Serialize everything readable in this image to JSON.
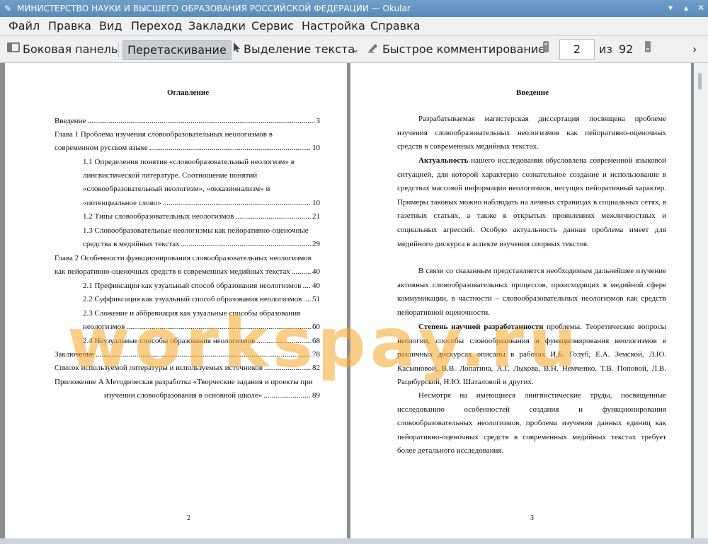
{
  "window": {
    "title": "МИНИСТЕРСТВО НАУКИ И ВЫСШЕГО ОБРАЗОВАНИЯ РОССИЙСКОЙ ФЕДЕРАЦИИ  — Okular",
    "icons": {
      "app": "okular-app-icon",
      "minimize": "minimize-icon",
      "maximize": "maximize-icon",
      "close": "close-icon"
    }
  },
  "menu": [
    "Файл",
    "Правка",
    "Вид",
    "Переход",
    "Закладки",
    "Сервис",
    "Настройка",
    "Справка"
  ],
  "toolbar": {
    "sidebar": "Боковая панель",
    "drag": "Перетаскивание",
    "select_text": "Выделение текста",
    "quick_comment": "Быстрое комментирование",
    "page_current": "2",
    "page_of": "из",
    "page_total": "92"
  },
  "left_page": {
    "title": "Оглавление",
    "page_number": "2",
    "toc": [
      {
        "text": "Введение",
        "page": "3"
      },
      {
        "text": "Глава 1 Проблема изучения словообразовательных неологизмов в",
        "page": ""
      },
      {
        "text": "современном русском языке",
        "page": "10"
      },
      {
        "text": "1.1 Определения понятия «словообразовательный неологизм» в",
        "page": ""
      },
      {
        "text": "лингвистической литературе. Соотношение понятий",
        "page": ""
      },
      {
        "text": "«словообразовательный неологизм», «окказионализм» и",
        "page": ""
      },
      {
        "text": "«потенциальное слово»",
        "page": "10"
      },
      {
        "text": "1.2 Типы словообразовательных неологизмов",
        "page": "21"
      },
      {
        "text": "1.3 Словообразовательные неологизмы как пейоративно-оценочные",
        "page": ""
      },
      {
        "text": "средства в медийных текстах",
        "page": "29"
      },
      {
        "text": "Глава 2 Особенности функционирования словообразовательных неологизмов",
        "page": ""
      },
      {
        "text": "как пейоративно-оценочных средств в современных медийных текстах",
        "page": "40"
      },
      {
        "text": "2.1 Префиксация как узуальный способ образования неологизмов",
        "page": "40"
      },
      {
        "text": "2.2 Суффиксация как узуальный способ образования неологизмов",
        "page": "51"
      },
      {
        "text": "2.3 Сложение и аббревиация как узуальные способы образования",
        "page": ""
      },
      {
        "text": "неологизмов",
        "page": "60"
      },
      {
        "text": "2.4 Неузуальные способы образования неологизмов",
        "page": "68"
      },
      {
        "text": "Заключение",
        "page": "78"
      },
      {
        "text": "Список используемой литературы и используемых источников",
        "page": "82"
      },
      {
        "text": "Приложение А Методическая разработка «Творческие задания и проекты при",
        "page": ""
      },
      {
        "text": "изучении словообразования в основной школе»",
        "page": "89"
      }
    ]
  },
  "right_page": {
    "title": "Введение",
    "page_number": "3",
    "paragraphs": [
      {
        "bold": "",
        "text": "Разрабатываемая магистерская диссертация посвящена проблеме изучения словообразовательных неологизмов как пейоративно-оценочных средств в современных медийных текстах."
      },
      {
        "bold": "Актуальность",
        "text": " нашего исследования обусловлена современной языковой ситуацией, для которой характерно сознательное создание и использование в средствах массовой информации неологизмов, несущих пейоративный характер. Примеры таковых можно наблюдать на личных страницах в социальных сетях, в газетных статьях, а также в открытых проявлениях межличностных и социальных агрессий. Особую актуальность данная проблема имеет для медийного дискурса в аспекте изучения спорных текстов."
      },
      {
        "bold": "",
        "text": "В связи со сказанным представляется необходимым дальнейшее изучение активных словообразовательных процессов, происходящих в медийной сфере коммуникации, в частности – словообразовательных неологизмов как средств пейоративной оценочности."
      },
      {
        "bold": "Степень научной разработанности",
        "text": " проблемы. Теоретические вопросы неологии, способы словообразования и функционирования неологизмов в различных дискурсах описаны в работах И.Б. Голуб, Е.А. Земской, Л.Ю. Касьяновой, В.В. Лопатина, А.Г. Лыкова, В.Н. Немченко, Т.В. Поповой, Л.В. Рацибурской, Н.Ю. Шаталовой и других."
      },
      {
        "bold": "",
        "text": "Несмотря на имеющиеся лингвистические труды, посвященные исследованию особенностей создания и функционирования словообразовательных неологизмов, проблема изучения данных единиц как пейоративно-оценочных средств в современных медийных текстах требует более детального исследования."
      }
    ]
  },
  "watermark": "workspay.ru",
  "colors": {
    "titlebar": "#6392bf",
    "watermark": "#f2a628"
  }
}
